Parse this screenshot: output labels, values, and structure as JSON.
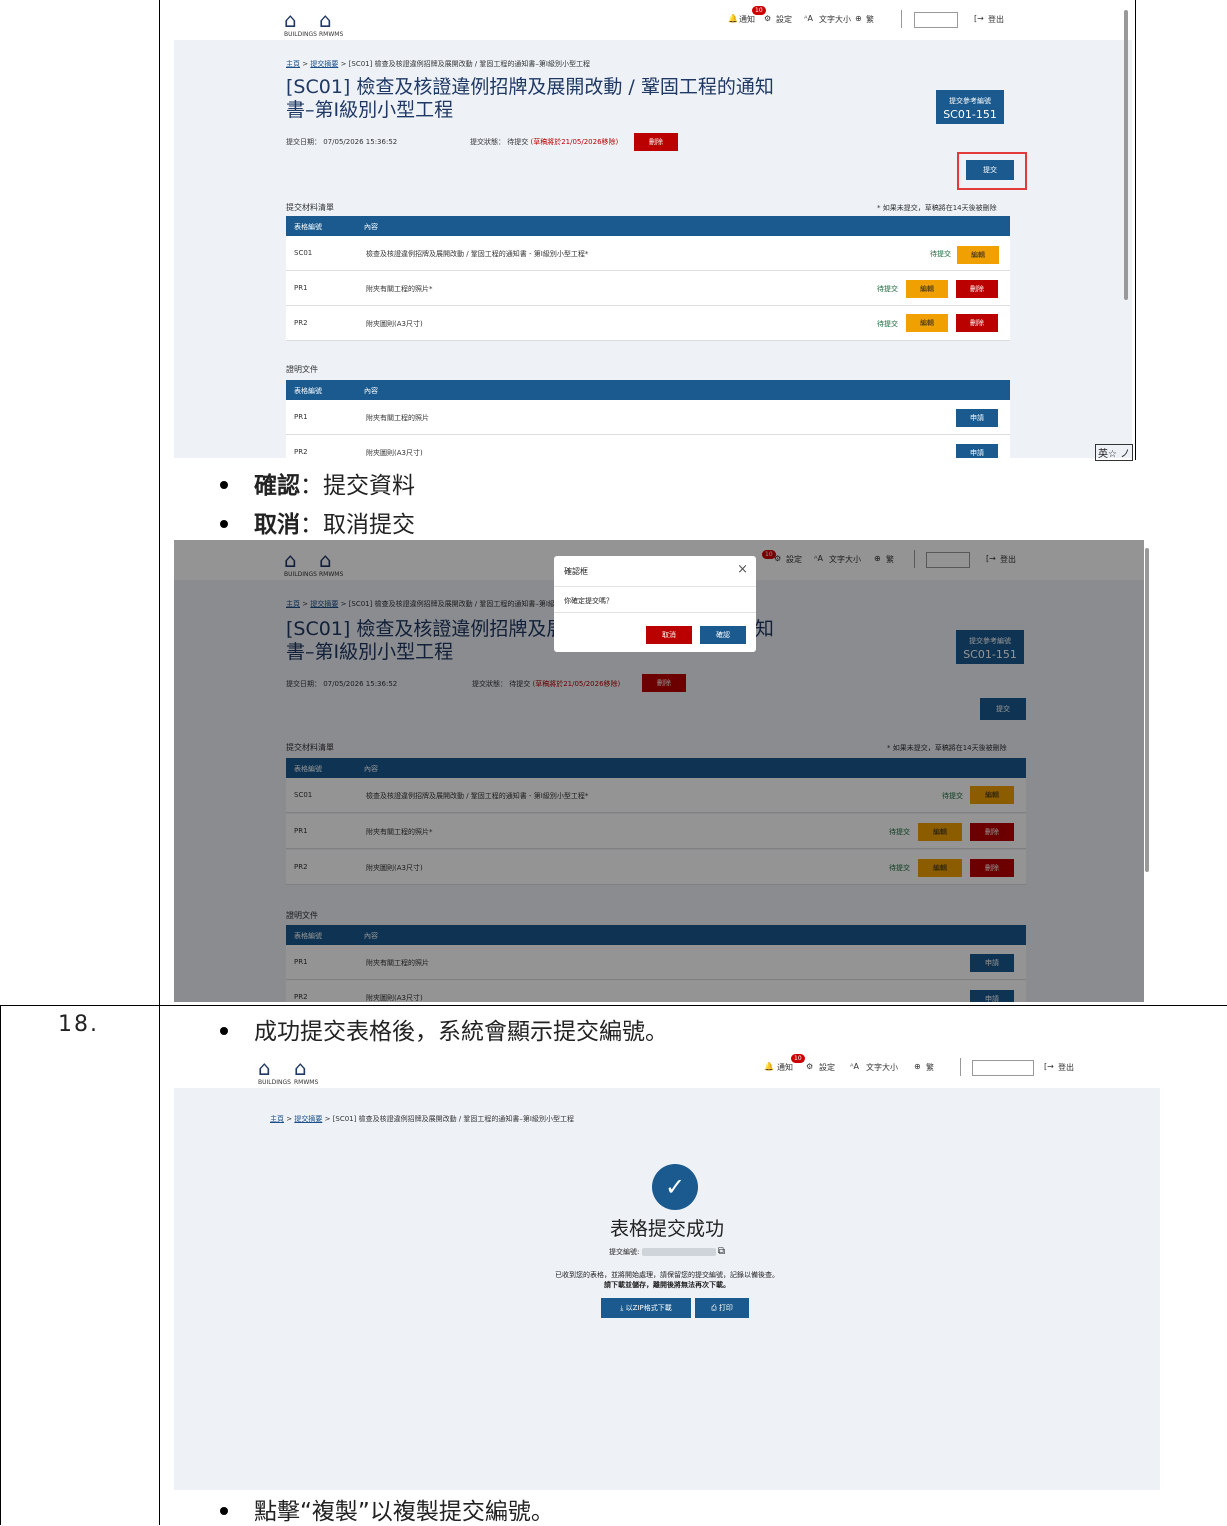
{
  "doc": {
    "row_number": "18.",
    "bullet_confirm_label": "確認",
    "bullet_confirm_text": "：提交資料",
    "bullet_cancel_label": "取消",
    "bullet_cancel_text": "：取消提交",
    "bullet_success": "成功提交表格後，系統會顯示提交編號。",
    "bullet_copy": "點擊“複製”以複製提交編號。",
    "ime_indicator": "英",
    "ime_mode": "☆ ノ"
  },
  "header": {
    "logo1": "⌂",
    "logo1_sub": "BUILDINGS",
    "logo2": "⌂",
    "logo2_sub": "RMWMS",
    "notify": "通知",
    "notify_count": "10",
    "settings": "設定",
    "font_size": "文字大小",
    "language": "繁",
    "logout": "登出"
  },
  "page": {
    "crumb_home": "主頁",
    "crumb_summary": "提交摘要",
    "crumb_current": "> [SC01] 檢查及核證違例招牌及展開改動 / 鞏固工程的通知書–第I級別小型工程",
    "title": "[SC01] 檢查及核證違例招牌及展開改動 / 鞏固工程的通知書–第I級別小型工程",
    "submit_date": "提交日期： 07/05/2026 15:36:52",
    "status_label": "提交狀態： 待提交",
    "status_note": "(草稿將於21/05/2026移除)",
    "delete_label": "刪除",
    "ref_label": "提交參考編號",
    "ref_value": "SC01-151",
    "submit_label": "提交",
    "materials_title": "提交材料清單",
    "materials_note": "* 如果未提交，草稿將在14天後被刪除",
    "col_form": "表格編號",
    "col_content": "內容",
    "rows": [
      {
        "code": "SC01",
        "content": "檢查及核證違例招牌及展開改動 / 鞏固工程的通知書 - 第I級別小型工程*",
        "status": "待提交",
        "edit": "編輯",
        "delete": ""
      },
      {
        "code": "PR1",
        "content": "附夾有關工程的照片*",
        "status": "待提交",
        "edit": "編輯",
        "delete": "刪除"
      },
      {
        "code": "PR2",
        "content": "附夾圖則(A3尺寸)",
        "status": "待提交",
        "edit": "編輯",
        "delete": "刪除"
      }
    ],
    "docs_title": "證明文件",
    "docs": [
      {
        "code": "PR1",
        "content": "附夾有關工程的照片",
        "action": "申請"
      },
      {
        "code": "PR2",
        "content": "附夾圖則(A3尺寸)",
        "action": "申請"
      }
    ]
  },
  "dialog": {
    "title": "確認框",
    "close": "×",
    "message": "你確定提交嗎？",
    "cancel": "取消",
    "confirm": "確認"
  },
  "success": {
    "crumb_current": "> [SC01] 檢查及核證違例招牌及展開改動 / 鞏固工程的通知書–第I級別小型工程",
    "check": "✓",
    "title": "表格提交成功",
    "number_label": "提交編號:",
    "copy_icon": "⧉",
    "line1": "已收到您的表格，並將開始處理，請保留您的提交編號，記錄以備後查。",
    "line2": "請下載並儲存，離開後將無法再次下載。",
    "zip_label": "以ZIP格式下載",
    "print_label": "打印"
  },
  "colors": {
    "primary": "#1a5a8f",
    "danger": "#b00000",
    "warning": "#f0a000",
    "highlight": "#e03a3a"
  }
}
